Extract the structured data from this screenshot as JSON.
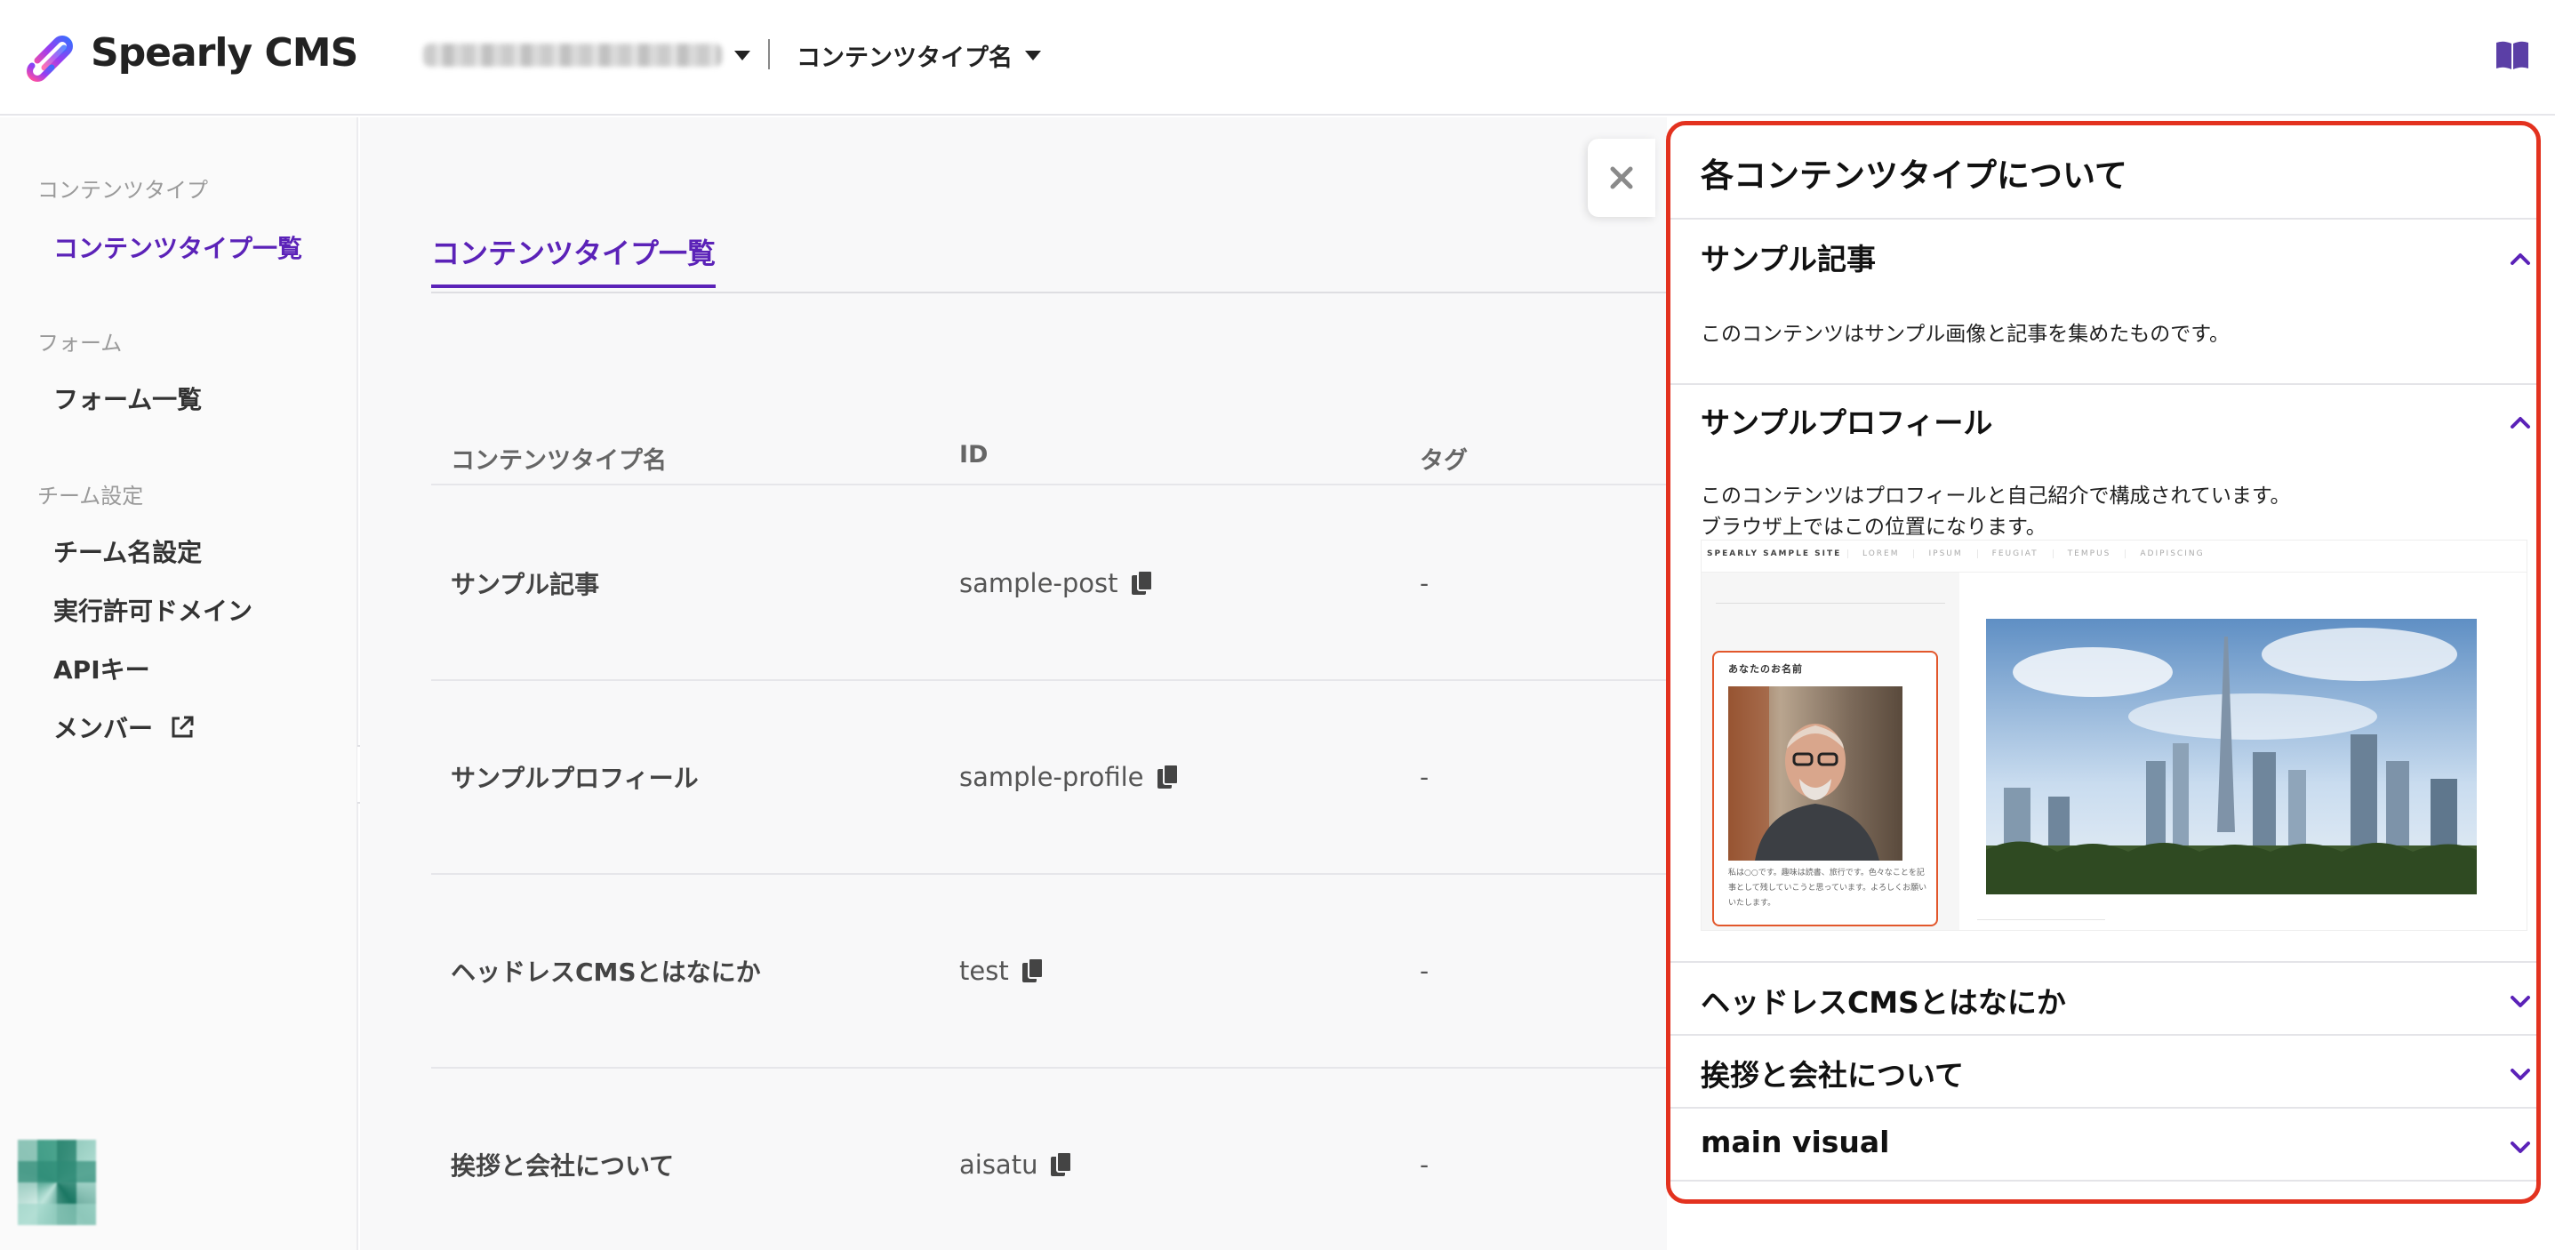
{
  "header": {
    "app_name": "Spearly CMS",
    "content_type_selector": "コンテンツタイプ名"
  },
  "sidebar": {
    "groups": [
      {
        "label": "コンテンツタイプ",
        "items": [
          "コンテンツタイプ一覧"
        ]
      },
      {
        "label": "フォーム",
        "items": [
          "フォーム一覧"
        ]
      },
      {
        "label": "チーム設定",
        "items": [
          "チーム名設定",
          "実行許可ドメイン",
          "APIキー",
          "メンバー"
        ]
      }
    ],
    "active_item": "コンテンツタイプ一覧"
  },
  "main": {
    "tab_label": "コンテンツタイプ一覧",
    "columns": [
      "コンテンツタイプ名",
      "ID",
      "タグ"
    ],
    "rows": [
      {
        "name": "サンプル記事",
        "id": "sample-post",
        "tag": "-"
      },
      {
        "name": "サンプルプロフィール",
        "id": "sample-profile",
        "tag": "-"
      },
      {
        "name": "ヘッドレスCMSとはなにか",
        "id": "test",
        "tag": "-"
      },
      {
        "name": "挨拶と会社について",
        "id": "aisatu",
        "tag": "-"
      }
    ]
  },
  "panel": {
    "title": "各コンテンツタイプについて",
    "sections": [
      {
        "title": "サンプル記事",
        "expanded": true,
        "description": [
          "このコンテンツはサンプル画像と記事を集めたものです。"
        ]
      },
      {
        "title": "サンプルプロフィール",
        "expanded": true,
        "description": [
          "このコンテンツはプロフィールと自己紹介で構成されています。",
          "ブラウザ上ではこの位置になります。"
        ]
      },
      {
        "title": "ヘッドレスCMSとはなにか",
        "expanded": false
      },
      {
        "title": "挨拶と会社について",
        "expanded": false
      },
      {
        "title": "main visual",
        "expanded": false
      }
    ],
    "preview": {
      "brand": "SPEARLY SAMPLE SITE",
      "menu": [
        "LOREM",
        "IPSUM",
        "FEUGIAT",
        "TEMPUS",
        "ADIPISCING"
      ],
      "card_title": "あなたのお名前",
      "card_text": "私は○○です。趣味は読書、旅行です。色々なことを記事として残していこうと思っています。よろしくお願いいたします。"
    }
  },
  "colors": {
    "accent": "#5b22b8",
    "highlight_border": "#e3321f",
    "chevron": "#5b22b8"
  },
  "icons": [
    "spearly-logo-icon",
    "caret-down-icon",
    "book-icon",
    "external-link-icon",
    "chevron-left-icon",
    "copy-icon",
    "close-icon",
    "chevron-up-icon",
    "chevron-down-icon"
  ]
}
